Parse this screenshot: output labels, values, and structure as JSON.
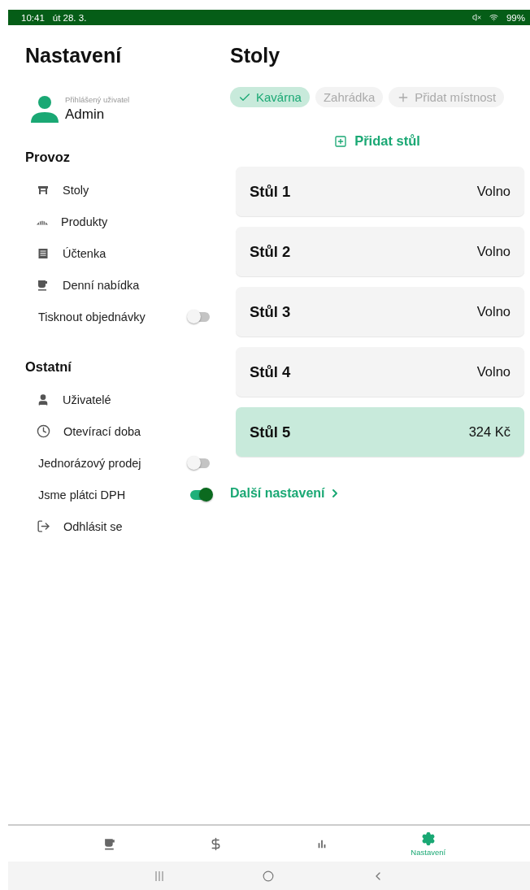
{
  "status_bar": {
    "time": "10:41",
    "date": "út 28. 3.",
    "battery": "99%"
  },
  "sidebar": {
    "title": "Nastavení",
    "user": {
      "caption": "Přihlášený uživatel",
      "name": "Admin"
    },
    "sections": [
      {
        "title": "Provoz",
        "items": [
          {
            "kind": "link",
            "label": "Stoly"
          },
          {
            "kind": "link",
            "label": "Produkty"
          },
          {
            "kind": "link",
            "label": "Účtenka"
          },
          {
            "kind": "link",
            "label": "Denní nabídka"
          },
          {
            "kind": "toggle",
            "label": "Tisknout objednávky",
            "on": false
          }
        ]
      },
      {
        "title": "Ostatní",
        "items": [
          {
            "kind": "link",
            "label": "Uživatelé"
          },
          {
            "kind": "link",
            "label": "Otevírací doba"
          },
          {
            "kind": "toggle",
            "label": "Jednorázový prodej",
            "on": false
          },
          {
            "kind": "toggle",
            "label": "Jsme plátci DPH",
            "on": true
          },
          {
            "kind": "link",
            "label": "Odhlásit se"
          }
        ]
      }
    ]
  },
  "main": {
    "title": "Stoly",
    "rooms": [
      {
        "kind": "room",
        "label": "Kavárna",
        "selected": true
      },
      {
        "kind": "room",
        "label": "Zahrádka",
        "selected": false
      },
      {
        "kind": "add",
        "label": "Přidat místnost",
        "selected": false
      }
    ],
    "add_table": "Přidat stůl",
    "tables": [
      {
        "name": "Stůl 1",
        "status": "Volno",
        "occupied": false
      },
      {
        "name": "Stůl 2",
        "status": "Volno",
        "occupied": false
      },
      {
        "name": "Stůl 3",
        "status": "Volno",
        "occupied": false
      },
      {
        "name": "Stůl 4",
        "status": "Volno",
        "occupied": false
      },
      {
        "name": "Stůl 5",
        "status": "324 Kč",
        "occupied": true
      }
    ],
    "more_settings": "Další nastavení"
  },
  "bottom_nav": [
    {
      "selected": false
    },
    {
      "selected": false
    },
    {
      "selected": false
    },
    {
      "label": "Nastavení",
      "selected": true
    }
  ]
}
